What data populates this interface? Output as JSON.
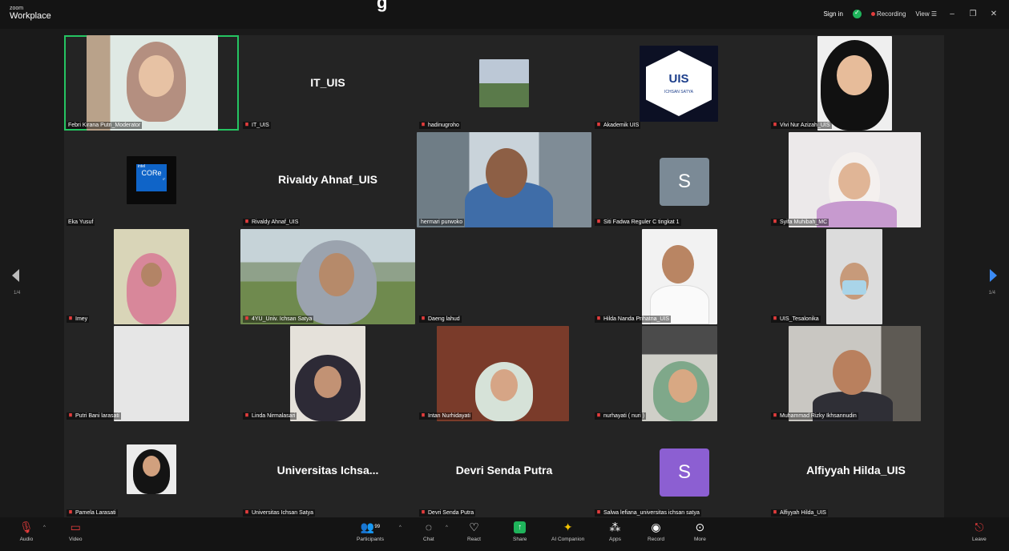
{
  "app": {
    "brand_small": "zoom",
    "brand": "Workplace",
    "cut_title": "g"
  },
  "titlebar": {
    "signin": "Sign in",
    "recording": "Recording",
    "view": "View ☰",
    "minimize": "–",
    "restore": "❐",
    "close": "✕"
  },
  "nav": {
    "left_page": "1/4",
    "right_page": "1/4"
  },
  "tiles": [
    {
      "name": "Febri Kirana Putri_Moderator",
      "display": "",
      "muted": false
    },
    {
      "name": "IT_UIS",
      "display": "IT_UIS",
      "muted": true
    },
    {
      "name": "hadinugroho",
      "display": "",
      "muted": true
    },
    {
      "name": "Akademik UIS",
      "display": "",
      "muted": true
    },
    {
      "name": "Vivi Nur Azizah_UIS",
      "display": "",
      "muted": true
    },
    {
      "name": "Eka Yusuf",
      "display": "",
      "muted": false
    },
    {
      "name": "Rivaldy Ahnaf_UIS",
      "display": "Rivaldy Ahnaf_UIS",
      "muted": true
    },
    {
      "name": "hermari purwoko",
      "display": "",
      "muted": false
    },
    {
      "name": "Siti Fadwa Reguler C tingkat 1",
      "display": "",
      "muted": true
    },
    {
      "name": "Syifa Muhibah_MC",
      "display": "",
      "muted": true
    },
    {
      "name": "Imey",
      "display": "",
      "muted": true
    },
    {
      "name": "4YU_Univ. Ichsan Satya",
      "display": "",
      "muted": true
    },
    {
      "name": "Daeng lahud",
      "display": "",
      "muted": true
    },
    {
      "name": "Hilda Nanda Prihatna_UIS",
      "display": "",
      "muted": true
    },
    {
      "name": "UIS_Tesalonika",
      "display": "",
      "muted": true
    },
    {
      "name": "Putri Bani larasati",
      "display": "",
      "muted": true
    },
    {
      "name": "Linda Nirmalasari",
      "display": "",
      "muted": true
    },
    {
      "name": "Intan Nurhidayati",
      "display": "",
      "muted": true
    },
    {
      "name": "nurhayati ( nuri )",
      "display": "",
      "muted": true
    },
    {
      "name": "Muhammad Rizky Ikhsannudin",
      "display": "",
      "muted": true
    },
    {
      "name": "Pamela Larasati",
      "display": "",
      "muted": true
    },
    {
      "name": "Universitas Ichsan Satya",
      "display": "Universitas Ichsa...",
      "muted": true
    },
    {
      "name": "Devri Senda Putra",
      "display": "Devri Senda Putra",
      "muted": true
    },
    {
      "name": "Salwa lefiana_universitas ichsan satya",
      "display": "",
      "muted": true
    },
    {
      "name": "Alfiyyah Hilda_UIS",
      "display": "Alfiyyah Hilda_UIS",
      "muted": true
    }
  ],
  "avatars": {
    "siti": "S",
    "salwa": "S",
    "logo_text": "UIS",
    "logo_sub": "ICHSAN SATYA",
    "intel_brand": "intel",
    "intel_core": "CORe",
    "intel_gen": "i7"
  },
  "toolbar": {
    "audio": "Audio",
    "video": "Video",
    "participants": "Participants",
    "participants_count": "99",
    "chat": "Chat",
    "react": "React",
    "share": "Share",
    "ai": "AI Companion",
    "apps": "Apps",
    "record": "Record",
    "more": "More",
    "leave": "Leave"
  },
  "colors": {
    "accent_green": "#25c462",
    "record_red": "#e23c3c",
    "nav_blue": "#3b8bf5",
    "avatar_gray": "#7b8a96",
    "avatar_purple": "#8c5fd2"
  }
}
